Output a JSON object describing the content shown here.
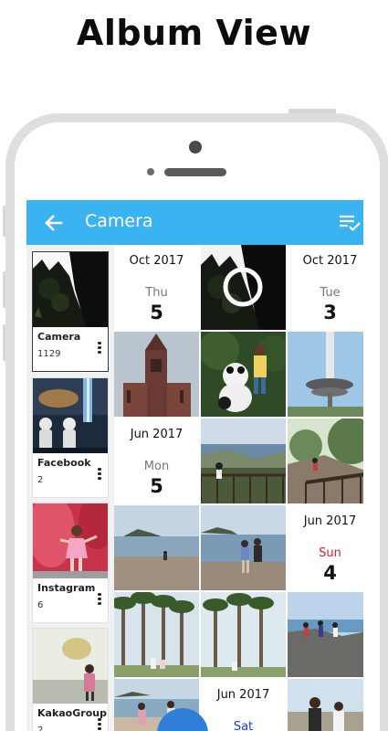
{
  "headline": "Album View",
  "appbar": {
    "title": "Camera",
    "back_icon": "arrow-left-icon",
    "sort_icon": "list-check-icon",
    "color": "#3ab3f0"
  },
  "albums": [
    {
      "name": "Camera",
      "count": "1129",
      "selected": true
    },
    {
      "name": "Facebook",
      "count": "2",
      "selected": false
    },
    {
      "name": "Instagram",
      "count": "6",
      "selected": false
    },
    {
      "name": "KakaoGroup",
      "count": "2",
      "selected": false
    }
  ],
  "date_headers": [
    {
      "month": "Oct 2017",
      "dow": "Thu",
      "day": "5",
      "dow_style": "normal"
    },
    {
      "month": "Oct 2017",
      "dow": "Tue",
      "day": "3",
      "dow_style": "normal"
    },
    {
      "month": "Jun 2017",
      "dow": "Mon",
      "day": "5",
      "dow_style": "normal"
    },
    {
      "month": "Jun 2017",
      "dow": "Sun",
      "day": "4",
      "dow_style": "sun"
    },
    {
      "month": "Jun 2017",
      "dow": "Sat",
      "day": "",
      "dow_style": "sat"
    }
  ],
  "photos": [
    {
      "subject": "tree-silhouette",
      "is_video": true
    },
    {
      "subject": "church-tower"
    },
    {
      "subject": "panda-statues"
    },
    {
      "subject": "seoul-tower"
    },
    {
      "subject": "coastal-boardwalk"
    },
    {
      "subject": "cliff-path"
    },
    {
      "subject": "island-beach"
    },
    {
      "subject": "girl-on-beach"
    },
    {
      "subject": "palm-trees"
    },
    {
      "subject": "palm-trees-people"
    },
    {
      "subject": "rocky-shore-group"
    },
    {
      "subject": "beach-walkers"
    },
    {
      "subject": "girl-with-adult"
    }
  ]
}
